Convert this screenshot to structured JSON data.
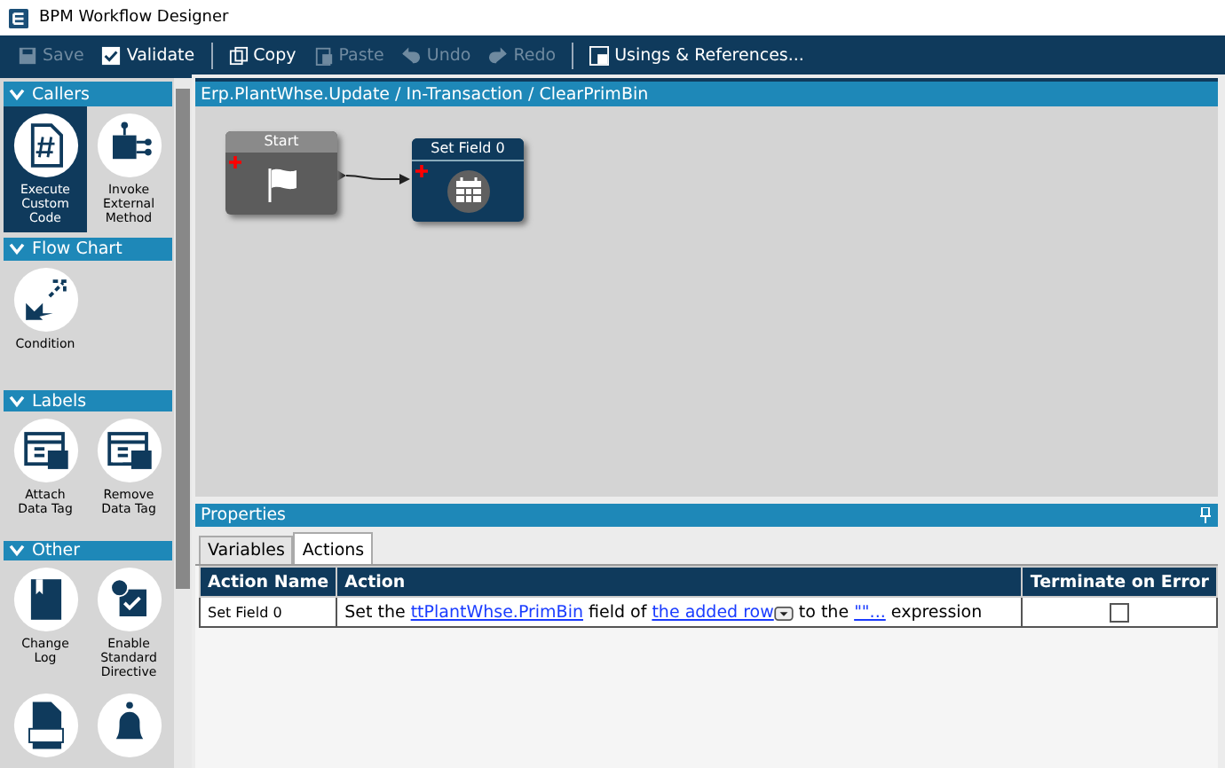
{
  "window": {
    "title": "BPM Workflow Designer"
  },
  "toolbar": [
    {
      "label": "Save",
      "kind": "save",
      "disabled": true
    },
    {
      "label": "Validate",
      "kind": "check",
      "disabled": false
    },
    {
      "label": "Copy",
      "kind": "copy",
      "disabled": false
    },
    {
      "label": "Paste",
      "kind": "paste",
      "disabled": true
    },
    {
      "label": "Undo",
      "kind": "undo",
      "disabled": true
    },
    {
      "label": "Redo",
      "kind": "redo",
      "disabled": true
    },
    {
      "label": "Usings & References...",
      "kind": "refs",
      "disabled": false
    }
  ],
  "palette": [
    {
      "title": "Callers",
      "items": [
        {
          "label": "Execute Custom Code",
          "kind": "code",
          "selected": true
        },
        {
          "label": "Invoke External Method",
          "kind": "method",
          "selected": false
        }
      ]
    },
    {
      "title": "Flow Chart",
      "items": [
        {
          "label": "Condition",
          "kind": "condition",
          "selected": false
        }
      ]
    },
    {
      "title": "Labels",
      "items": [
        {
          "label": "Attach Data Tag",
          "kind": "tag-add",
          "selected": false
        },
        {
          "label": "Remove Data Tag",
          "kind": "tag-remove",
          "selected": false
        }
      ]
    },
    {
      "title": "Other",
      "items": [
        {
          "label": "Change Log",
          "kind": "book",
          "selected": false
        },
        {
          "label": "Enable Standard Directive",
          "kind": "enable",
          "selected": false
        },
        {
          "kind": "log",
          "selected": false
        },
        {
          "kind": "bell",
          "selected": false
        }
      ]
    }
  ],
  "canvas": {
    "breadcrumb": "Erp.PlantWhse.Update / In-Transaction / ClearPrimBin",
    "nodes": [
      {
        "title": "Start",
        "kind": "start"
      },
      {
        "title": "Set Field 0",
        "kind": "setfield"
      }
    ]
  },
  "properties": {
    "title": "Properties",
    "tabs": [
      {
        "label": "Variables",
        "selected": false
      },
      {
        "label": "Actions",
        "selected": true
      }
    ],
    "table": {
      "columns": [
        "Action Name",
        "Action",
        "Terminate on Error"
      ],
      "rows": [
        {
          "name": "Set Field 0",
          "action": [
            {
              "kind": "text",
              "text": "Set the "
            },
            {
              "kind": "link",
              "text": "ttPlantWhse.PrimBin"
            },
            {
              "kind": "text",
              "text": " field of "
            },
            {
              "kind": "link",
              "text": "the added row"
            },
            {
              "kind": "dropdown"
            },
            {
              "kind": "text",
              "text": " to the "
            },
            {
              "kind": "link",
              "text": "\"\"..."
            },
            {
              "kind": "text",
              "text": " expression"
            }
          ],
          "terminate_on_error": false
        }
      ]
    }
  }
}
